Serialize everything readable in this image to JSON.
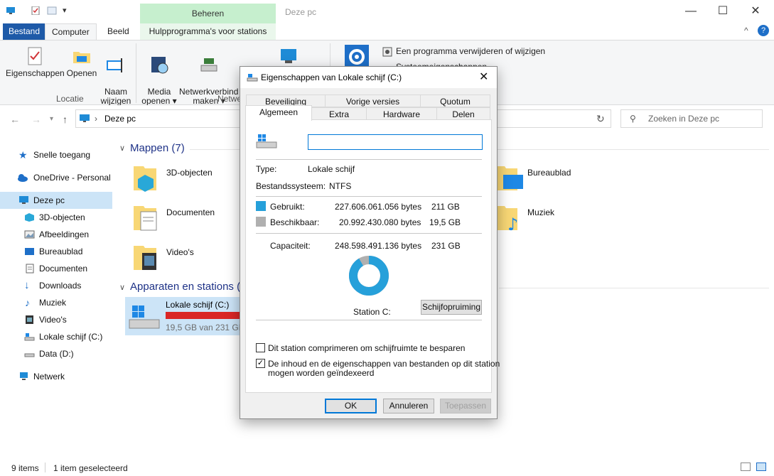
{
  "window": {
    "title": "Deze pc",
    "context_tab_header": "Beheren",
    "minimize_glyph": "—",
    "maximize_glyph": "☐",
    "close_glyph": "✕"
  },
  "ribbon_tabs": [
    {
      "label": "Bestand"
    },
    {
      "label": "Computer"
    },
    {
      "label": "Beeld"
    },
    {
      "label": "Hulpprogramma's voor stations"
    }
  ],
  "ribbon": {
    "buttons": [
      {
        "label": "Eigenschappen"
      },
      {
        "label": "Openen"
      },
      {
        "label": "Naam\nwijzigen"
      },
      {
        "label": "Media\nopenen ▾"
      },
      {
        "label": "Netwerkverbindi\nmaken ▾"
      }
    ],
    "group_locatie": "Locatie",
    "group_netwerk": "Netwe",
    "small_uninstall": "Een programma verwijderen of wijzigen",
    "small_system": "Systeemeigenschappen"
  },
  "address": {
    "path": "Deze pc",
    "search_placeholder": "Zoeken in Deze pc"
  },
  "sidebar": {
    "items": [
      {
        "label": "Snelle toegang",
        "icon": "star-icon"
      },
      {
        "label": "OneDrive - Personal",
        "icon": "cloud-icon"
      },
      {
        "label": "Deze pc",
        "icon": "computer-icon"
      },
      {
        "label": "3D-objecten",
        "icon": "cube-icon"
      },
      {
        "label": "Afbeeldingen",
        "icon": "pictures-icon"
      },
      {
        "label": "Bureaublad",
        "icon": "desktop-icon"
      },
      {
        "label": "Documenten",
        "icon": "document-icon"
      },
      {
        "label": "Downloads",
        "icon": "download-icon"
      },
      {
        "label": "Muziek",
        "icon": "music-icon"
      },
      {
        "label": "Video's",
        "icon": "video-icon"
      },
      {
        "label": "Lokale schijf (C:)",
        "icon": "drive-icon"
      },
      {
        "label": "Data (D:)",
        "icon": "drive-icon"
      },
      {
        "label": "Netwerk",
        "icon": "network-icon"
      }
    ]
  },
  "main": {
    "folders_title": "Mappen (7)",
    "folders": [
      {
        "label": "3D-objecten"
      },
      {
        "label": "Documenten"
      },
      {
        "label": "Video's"
      },
      {
        "label": "Bureaublad"
      },
      {
        "label": "Muziek"
      }
    ],
    "devices_title": "Apparaten en stations (",
    "drive": {
      "name": "Lokale schijf (C:)",
      "free_text": "19,5 GB van 231 GB",
      "used_fraction": 0.91
    }
  },
  "status": {
    "items": "9 items",
    "selected": "1 item geselecteerd"
  },
  "dialog": {
    "title": "Eigenschappen van Lokale schijf (C:)",
    "tabs_back": [
      "Beveiliging",
      "Vorige versies",
      "Quotum"
    ],
    "tabs_front": [
      "Algemeen",
      "Extra",
      "Hardware",
      "Delen"
    ],
    "name_value": "",
    "type_label": "Type:",
    "type_value": "Lokale schijf",
    "fs_label": "Bestandssysteem:",
    "fs_value": "NTFS",
    "used_label": "Gebruikt:",
    "used_bytes": "227.606.061.056 bytes",
    "used_gb": "211 GB",
    "free_label": "Beschikbaar:",
    "free_bytes": "20.992.430.080 bytes",
    "free_gb": "19,5 GB",
    "cap_label": "Capaciteit:",
    "cap_bytes": "248.598.491.136 bytes",
    "cap_gb": "231 GB",
    "station_label": "Station C:",
    "cleanup_button": "Schijfopruiming",
    "compress_label": "Dit station comprimeren om schijfruimte te besparen",
    "compress_checked": false,
    "index_label_1": "De inhoud en de eigenschappen van bestanden op dit station",
    "index_label_2": "mogen worden geïndexeerd",
    "index_checked": true,
    "ok": "OK",
    "cancel": "Annuleren",
    "apply": "Toepassen",
    "used_color": "#26a0da",
    "free_color": "#b0b0b0",
    "used_fraction": 0.9156
  }
}
